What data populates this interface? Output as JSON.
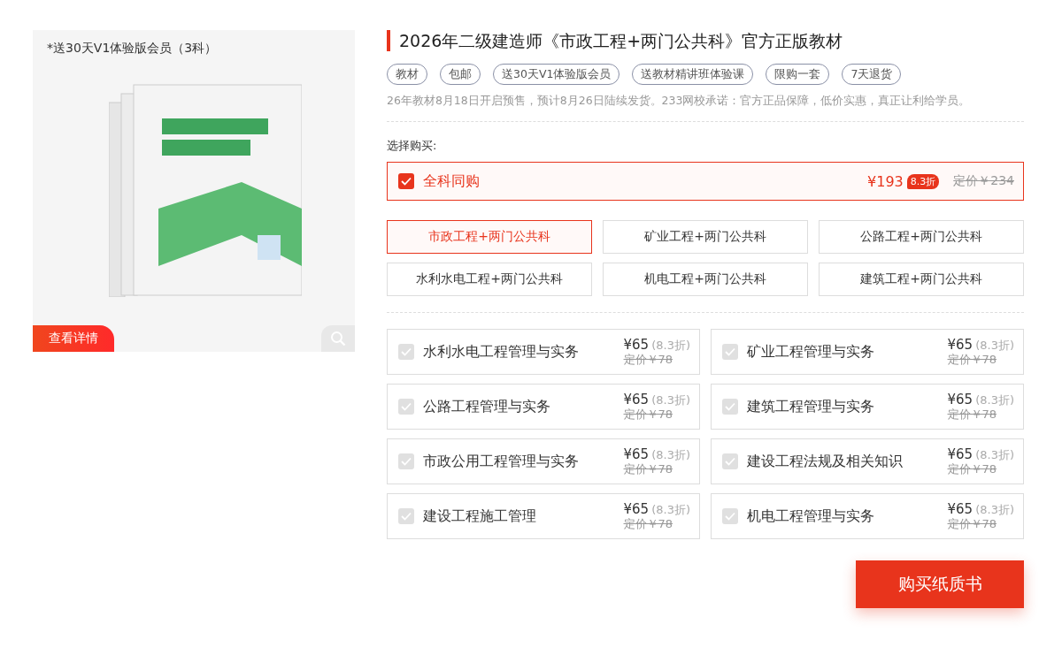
{
  "product_image": {
    "caption": "*送30天V1体验版会员（3科）",
    "detail_button": "查看详情"
  },
  "title": "2026年二级建造师《市政工程+两门公共科》官方正版教材",
  "tags": [
    "教材",
    "包邮",
    "送30天V1体验版会员",
    "送教材精讲班体验课",
    "限购一套",
    "7天退货"
  ],
  "notice": "26年教材8月18日开启预售，预计8月26日陆续发货。233网校承诺：官方正品保障，低价实惠，真正让利给学员。",
  "choose_label": "选择购买:",
  "bundle": {
    "label": "全科同购",
    "checked": true,
    "price": "¥193",
    "discount": "8.3折",
    "list_price": "定价￥234"
  },
  "options": [
    {
      "label": "市政工程+两门公共科",
      "selected": true
    },
    {
      "label": "矿业工程+两门公共科",
      "selected": false
    },
    {
      "label": "公路工程+两门公共科",
      "selected": false
    },
    {
      "label": "水利水电工程+两门公共科",
      "selected": false
    },
    {
      "label": "机电工程+两门公共科",
      "selected": false
    },
    {
      "label": "建筑工程+两门公共科",
      "selected": false
    }
  ],
  "items": [
    {
      "name": "水利水电工程管理与实务",
      "checked": true,
      "disabled": true,
      "price": "¥65",
      "discount": "(8.3折)",
      "list_price": "定价￥78"
    },
    {
      "name": "矿业工程管理与实务",
      "checked": true,
      "disabled": true,
      "price": "¥65",
      "discount": "(8.3折)",
      "list_price": "定价￥78"
    },
    {
      "name": "公路工程管理与实务",
      "checked": true,
      "disabled": true,
      "price": "¥65",
      "discount": "(8.3折)",
      "list_price": "定价￥78"
    },
    {
      "name": "建筑工程管理与实务",
      "checked": true,
      "disabled": true,
      "price": "¥65",
      "discount": "(8.3折)",
      "list_price": "定价￥78"
    },
    {
      "name": "市政公用工程管理与实务",
      "checked": true,
      "disabled": true,
      "price": "¥65",
      "discount": "(8.3折)",
      "list_price": "定价￥78"
    },
    {
      "name": "建设工程法规及相关知识",
      "checked": true,
      "disabled": true,
      "price": "¥65",
      "discount": "(8.3折)",
      "list_price": "定价￥78"
    },
    {
      "name": "建设工程施工管理",
      "checked": true,
      "disabled": true,
      "price": "¥65",
      "discount": "(8.3折)",
      "list_price": "定价￥78"
    },
    {
      "name": "机电工程管理与实务",
      "checked": true,
      "disabled": true,
      "price": "¥65",
      "discount": "(8.3折)",
      "list_price": "定价￥78"
    }
  ],
  "buy_button": "购买纸质书"
}
